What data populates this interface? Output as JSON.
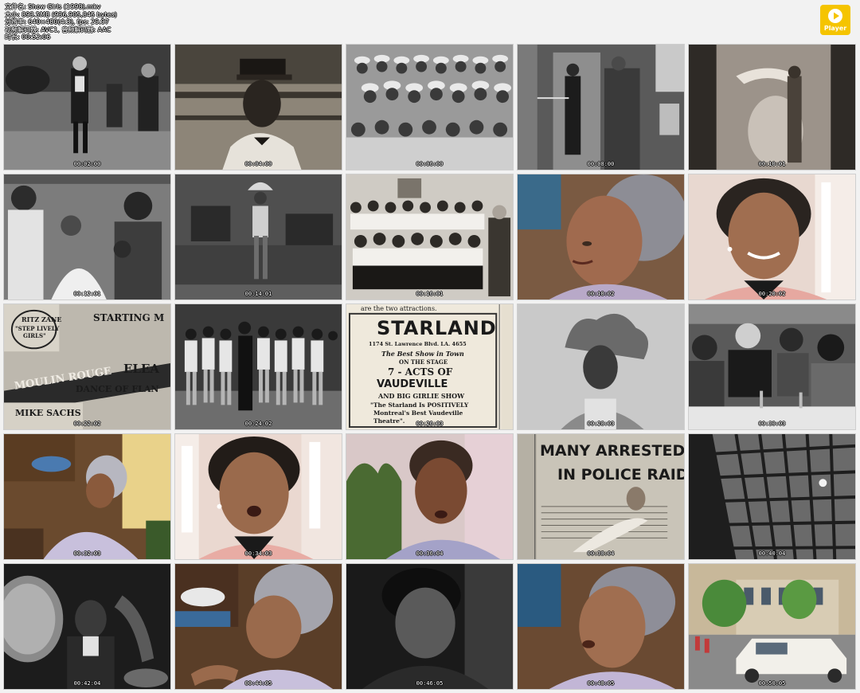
{
  "header": {
    "line1": "文件名: Show Girls (1998).mkv",
    "line2": "大小: 893.5MB (936,905,845 bytes)",
    "line3": "分辨率: 640×480(4:3), fps: 29.97",
    "line4": "视频解码器: AVC1, 音频解码器: AAC",
    "line5": "时长: 00:52:06"
  },
  "player_button": {
    "label": "Player",
    "icon": "play-circle-icon"
  },
  "thumbnails": [
    {
      "timestamp": "00:02:00",
      "scene": "dancers-tuxedo"
    },
    {
      "timestamp": "00:04:00",
      "scene": "porter-cap"
    },
    {
      "timestamp": "00:06:00",
      "scene": "group-hats"
    },
    {
      "timestamp": "00:08:00",
      "scene": "doorway"
    },
    {
      "timestamp": "00:10:01",
      "scene": "dancer-pose"
    },
    {
      "timestamp": "00:12:01",
      "scene": "party-group"
    },
    {
      "timestamp": "00:14:01",
      "scene": "stage-dancer"
    },
    {
      "timestamp": "00:16:01",
      "scene": "chorus-line-photo"
    },
    {
      "timestamp": "00:18:02",
      "scene": "interview-gray-hair"
    },
    {
      "timestamp": "00:20:02",
      "scene": "interview-smile"
    },
    {
      "timestamp": "00:22:02",
      "scene": "newspaper-ads"
    },
    {
      "timestamp": "00:24:02",
      "scene": "chorus-line-row"
    },
    {
      "timestamp": "00:26:03",
      "scene": "starland-ad"
    },
    {
      "timestamp": "00:28:03",
      "scene": "headdress-portrait"
    },
    {
      "timestamp": "00:30:03",
      "scene": "nightclub-table"
    },
    {
      "timestamp": "00:32:03",
      "scene": "interview-wide"
    },
    {
      "timestamp": "00:34:03",
      "scene": "interview-talking"
    },
    {
      "timestamp": "00:36:04",
      "scene": "interview-plant"
    },
    {
      "timestamp": "00:38:04",
      "scene": "police-raid-headline"
    },
    {
      "timestamp": "00:40:04",
      "scene": "window-grille"
    },
    {
      "timestamp": "00:42:04",
      "scene": "drummer"
    },
    {
      "timestamp": "00:44:05",
      "scene": "interview-profile"
    },
    {
      "timestamp": "00:46:05",
      "scene": "portrait-dark"
    },
    {
      "timestamp": "00:48:05",
      "scene": "interview-gray-hair-2"
    },
    {
      "timestamp": "00:50:05",
      "scene": "street-parade"
    }
  ],
  "texts": {
    "ad_ritz_zane": "RITZ ZANE",
    "ad_step_lively": "\"STEP LIVELY",
    "ad_girls": "GIRLS\"",
    "ad_starting": "STARTING M",
    "ad_moulin": "MOULIN ROUGE",
    "ad_elea": "ELEA",
    "ad_dance_of_fla": "DANCE OF FLAN",
    "ad_mike_sachs": "MIKE SACHS",
    "starland_top": "are the two attractions.",
    "starland_title": "STARLAND",
    "starland_address": "1174 St. Lawrence Blvd.   LA. 4655",
    "starland_best": "The Best Show in Town",
    "starland_on_stage": "ON THE STAGE",
    "starland_acts": "7 - ACTS OF",
    "starland_vaudeville": "VAUDEVILLE",
    "starland_girlie": "AND BIG GIRLIE SHOW",
    "starland_quote1": "\"The Starland Is POSITIVELY",
    "starland_quote2": "Montreal's Best Vaudeville",
    "starland_quote3": "Theatre\".",
    "raid_line1": "MANY ARRESTED",
    "raid_line2": "IN POLICE RAID"
  }
}
